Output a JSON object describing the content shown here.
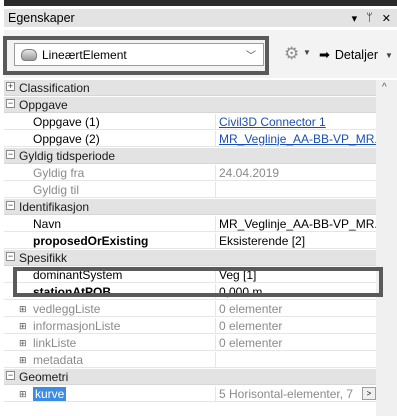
{
  "panel": {
    "title": "Egenskaper",
    "buttons": {
      "menu": "▾",
      "pin": "ᛘ",
      "close": "✕"
    }
  },
  "toolbar": {
    "combo_value": "LineærtElement",
    "details_label": "Detaljer"
  },
  "rows": [
    {
      "type": "category",
      "expander": "+",
      "name": "Classification"
    },
    {
      "type": "category",
      "expander": "−",
      "name": "Oppgave"
    },
    {
      "type": "prop",
      "name": "Oppgave (1)",
      "value": "Civil3D Connector 1",
      "link": true
    },
    {
      "type": "prop",
      "name": "Oppgave (2)",
      "value": "MR_Veglinje_AA-BB-VP_MR...",
      "link": true
    },
    {
      "type": "category",
      "expander": "−",
      "name": "Gyldig tidsperiode"
    },
    {
      "type": "prop",
      "name": "Gyldig fra",
      "value": "24.04.2019",
      "muted": true
    },
    {
      "type": "prop",
      "name": "Gyldig til",
      "value": "",
      "muted": true
    },
    {
      "type": "category",
      "expander": "−",
      "name": "Identifikasjon"
    },
    {
      "type": "prop",
      "name": "Navn",
      "value": "MR_Veglinje_AA-BB-VP_MR..."
    },
    {
      "type": "prop",
      "name": "proposedOrExisting",
      "value": "Eksisterende [2]",
      "bold": true
    },
    {
      "type": "category",
      "expander": "−",
      "name": "Spesifikk"
    },
    {
      "type": "prop",
      "name": "dominantSystem",
      "value": "Veg [1]"
    },
    {
      "type": "prop",
      "name": "stationAtPOB",
      "value": "0,000 m",
      "bold": true
    },
    {
      "type": "sub",
      "name": "vedleggListe",
      "value": "0 elementer"
    },
    {
      "type": "sub",
      "name": "informasjonListe",
      "value": "0 elementer"
    },
    {
      "type": "sub",
      "name": "linkListe",
      "value": "0 elementer"
    },
    {
      "type": "sub",
      "name": "metadata",
      "value": ""
    },
    {
      "type": "category",
      "expander": "−",
      "name": "Geometri"
    },
    {
      "type": "selected",
      "name": "kurve",
      "value": "5 Horisontal-elementer, 7"
    }
  ],
  "icons": {
    "combo_icon": "element-icon",
    "gear": "gear-icon",
    "details_arrow": "arrow-right-icon",
    "scroll_up": "scroll-up-icon"
  }
}
